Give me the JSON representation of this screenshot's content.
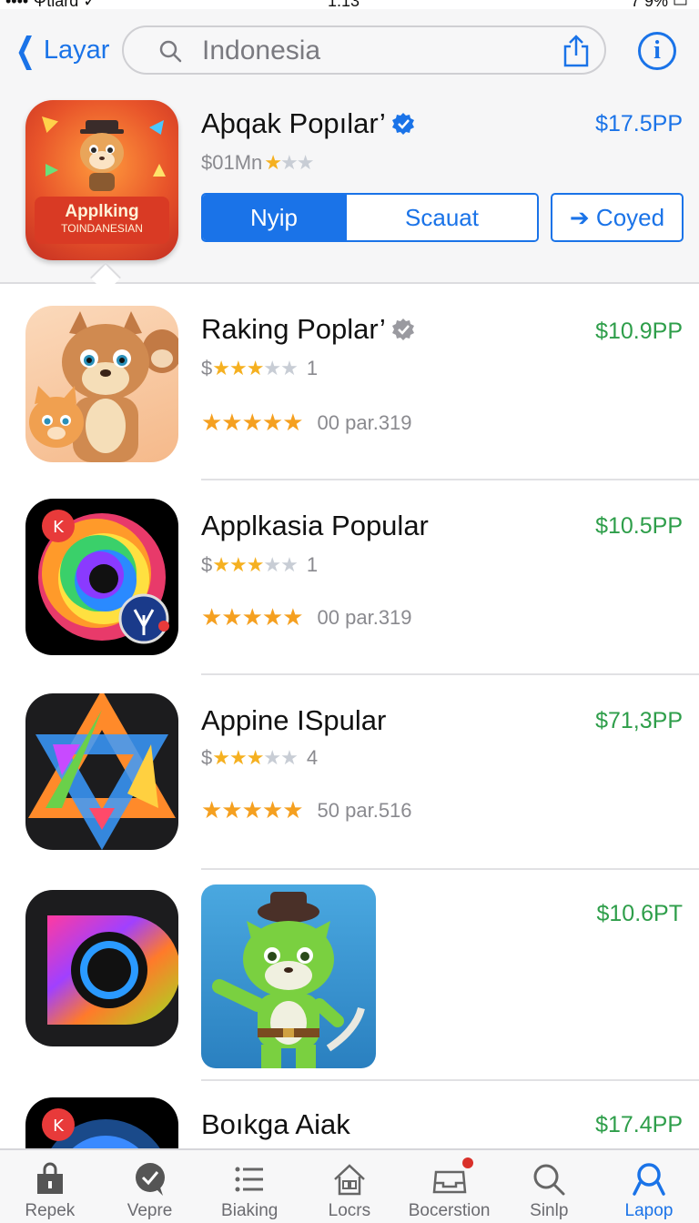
{
  "status_bar": {
    "carrier": "•••• Ψtlard ✓",
    "time": "1:13",
    "battery": "7 9%  ▭"
  },
  "nav": {
    "back_label": "Layar",
    "search_value": "Indonesia",
    "back_icon": "chevron-left-icon",
    "share_icon": "share-icon",
    "info_icon": "info-icon",
    "info_glyph": "i"
  },
  "featured": {
    "title": "Aþqak Popılar’",
    "price": "$17.5PP",
    "subtitle": "$01Mn",
    "stars_on": "★",
    "stars_off": "★★",
    "icon_line1": "Applking",
    "icon_line2": "TOINDANESIAN",
    "segments": [
      "Nyip",
      "Scauat"
    ],
    "active_segment": 0,
    "copy_button": "➔ Coyed"
  },
  "apps": [
    {
      "title": "Raking Poplar’",
      "price": "$10.9PP",
      "rating_prefix": "$",
      "rating_on": "★★★",
      "rating_off": "★★",
      "rating_count": "1",
      "stars5": "★★★★★",
      "reviews": "00 par.319",
      "verified": true
    },
    {
      "title": "Applkasia Popular",
      "price": "$10.5PP",
      "rating_prefix": "$",
      "rating_on": "★★★",
      "rating_off": "★★",
      "rating_count": "1",
      "stars5": "★★★★★",
      "reviews": "00 par.319",
      "verified": false
    },
    {
      "title": "Appine ISpular",
      "price": "$71,3PP",
      "rating_prefix": "$",
      "rating_on": "★★★",
      "rating_off": "★★",
      "rating_count": "4",
      "stars5": "★★★★★",
      "reviews": "50 par.516",
      "verified": false
    },
    {
      "title": "",
      "price": "$10.6PT"
    },
    {
      "title": "Boıkga Aiak",
      "price": "$17.4PP"
    }
  ],
  "tabs": [
    {
      "label": "Repek",
      "icon": "bag-icon"
    },
    {
      "label": "Vepre",
      "icon": "chat-icon"
    },
    {
      "label": "Biaking",
      "icon": "list-icon"
    },
    {
      "label": "Locrs",
      "icon": "house-icon"
    },
    {
      "label": "Bocerstion",
      "icon": "inbox-icon"
    },
    {
      "label": "Sinlp",
      "icon": "search-icon"
    },
    {
      "label": "Lapop",
      "icon": "person-search-icon"
    }
  ],
  "active_tab": 6,
  "colors": {
    "accent": "#1a73e8",
    "price_green": "#2e9e4a",
    "star": "#f5a020"
  }
}
